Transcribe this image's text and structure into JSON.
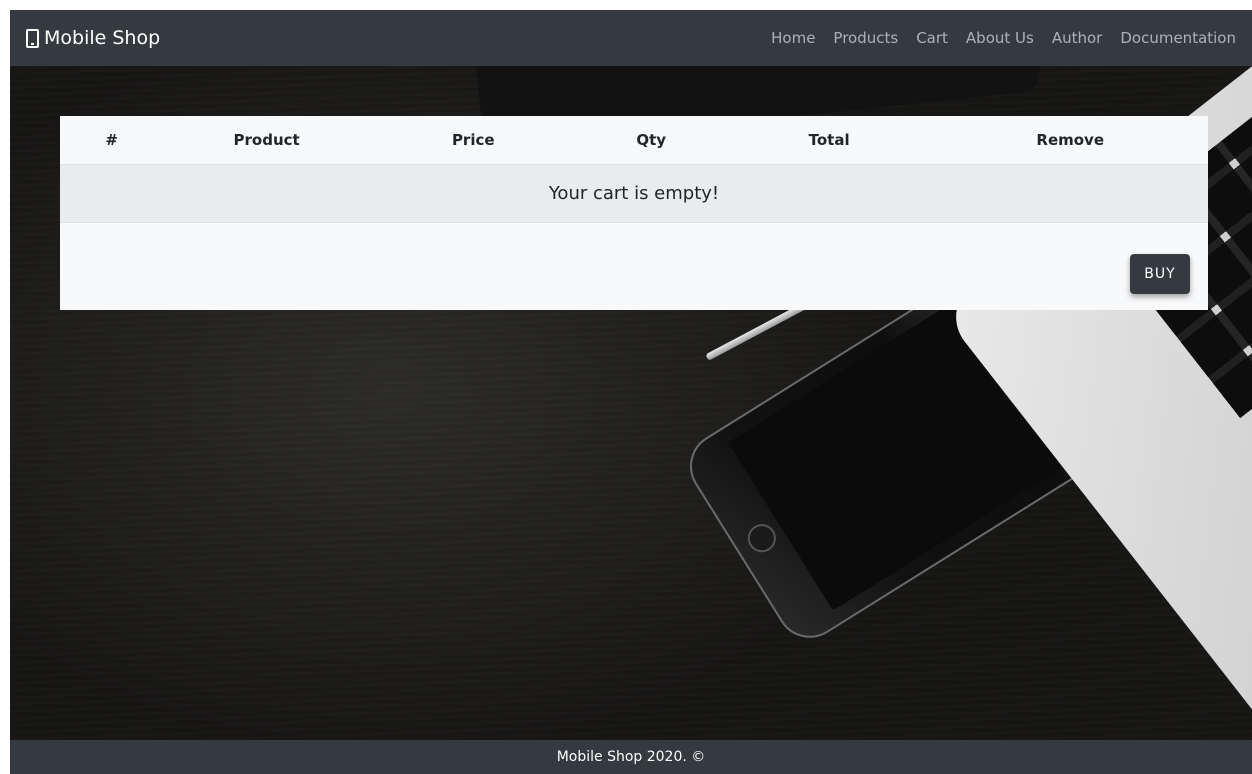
{
  "brand": {
    "label": "Mobile Shop",
    "icon": "mobile-phone-icon"
  },
  "nav": {
    "items": [
      "Home",
      "Products",
      "Cart",
      "About Us",
      "Author",
      "Documentation"
    ]
  },
  "cart": {
    "columns": [
      "#",
      "Product",
      "Price",
      "Qty",
      "Total",
      "Remove"
    ],
    "empty_message": "Your cart is empty!",
    "buy_label": "BUY"
  },
  "footer": {
    "text": "Mobile Shop 2020. ©"
  },
  "colors": {
    "navbar": "#343a40",
    "card": "#f8f9fa",
    "empty_row": "#e9ecef",
    "button": "#343a40"
  }
}
